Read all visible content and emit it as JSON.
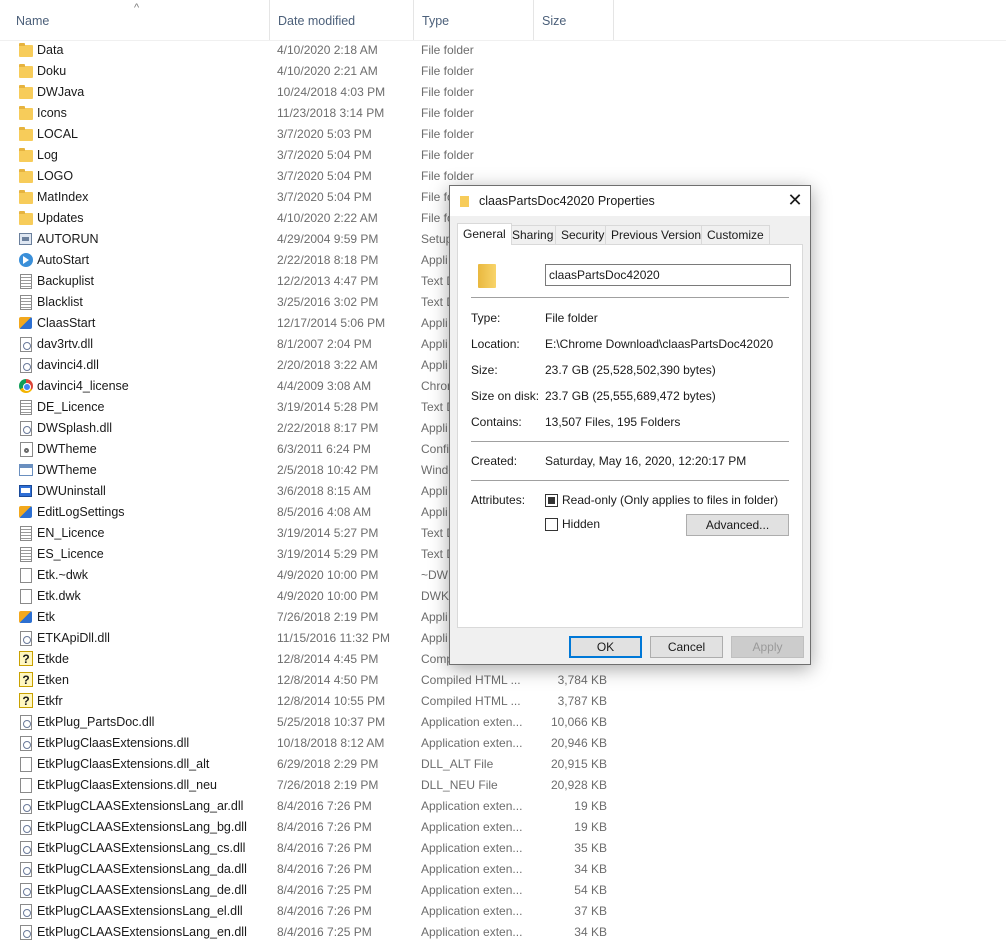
{
  "columns": {
    "name": "Name",
    "date": "Date modified",
    "type": "Type",
    "size": "Size"
  },
  "files": [
    {
      "icon": "folder-icon",
      "name": "Data",
      "date": "4/10/2020 2:18 AM",
      "type": "File folder",
      "size": ""
    },
    {
      "icon": "folder-icon",
      "name": "Doku",
      "date": "4/10/2020 2:21 AM",
      "type": "File folder",
      "size": ""
    },
    {
      "icon": "folder-icon",
      "name": "DWJava",
      "date": "10/24/2018 4:03 PM",
      "type": "File folder",
      "size": ""
    },
    {
      "icon": "folder-icon",
      "name": "Icons",
      "date": "11/23/2018 3:14 PM",
      "type": "File folder",
      "size": ""
    },
    {
      "icon": "folder-icon",
      "name": "LOCAL",
      "date": "3/7/2020 5:03 PM",
      "type": "File folder",
      "size": ""
    },
    {
      "icon": "folder-icon",
      "name": "Log",
      "date": "3/7/2020 5:04 PM",
      "type": "File folder",
      "size": ""
    },
    {
      "icon": "folder-icon",
      "name": "LOGO",
      "date": "3/7/2020 5:04 PM",
      "type": "File folder",
      "size": ""
    },
    {
      "icon": "folder-icon",
      "name": "MatIndex",
      "date": "3/7/2020 5:04 PM",
      "type": "File fo",
      "size": ""
    },
    {
      "icon": "folder-icon",
      "name": "Updates",
      "date": "4/10/2020 2:22 AM",
      "type": "File fo",
      "size": ""
    },
    {
      "icon": "setup-icon",
      "name": "AUTORUN",
      "date": "4/29/2004 9:59 PM",
      "type": "Setup",
      "size": ""
    },
    {
      "icon": "autostart-icon",
      "name": "AutoStart",
      "date": "2/22/2018 8:18 PM",
      "type": "Appli",
      "size": ""
    },
    {
      "icon": "text-file-icon",
      "name": "Backuplist",
      "date": "12/2/2013 4:47 PM",
      "type": "Text D",
      "size": ""
    },
    {
      "icon": "text-file-icon",
      "name": "Blacklist",
      "date": "3/25/2016 3:02 PM",
      "type": "Text D",
      "size": ""
    },
    {
      "icon": "app-icon",
      "name": "ClaasStart",
      "date": "12/17/2014 5:06 PM",
      "type": "Appli",
      "size": ""
    },
    {
      "icon": "dll-icon",
      "name": "dav3rtv.dll",
      "date": "8/1/2007 2:04 PM",
      "type": "Appli",
      "size": ""
    },
    {
      "icon": "dll-icon",
      "name": "davinci4.dll",
      "date": "2/20/2018 3:22 AM",
      "type": "Appli",
      "size": ""
    },
    {
      "icon": "chrome-icon",
      "name": "davinci4_license",
      "date": "4/4/2009 3:08 AM",
      "type": "Chron",
      "size": ""
    },
    {
      "icon": "text-file-icon",
      "name": "DE_Licence",
      "date": "3/19/2014 5:28 PM",
      "type": "Text D",
      "size": ""
    },
    {
      "icon": "dll-icon",
      "name": "DWSplash.dll",
      "date": "2/22/2018 8:17 PM",
      "type": "Appli",
      "size": ""
    },
    {
      "icon": "config-icon",
      "name": "DWTheme",
      "date": "6/3/2011 6:24 PM",
      "type": "Confi",
      "size": ""
    },
    {
      "icon": "window-icon",
      "name": "DWTheme",
      "date": "2/5/2018 10:42 PM",
      "type": "Windo",
      "size": ""
    },
    {
      "icon": "app-window-icon",
      "name": "DWUninstall",
      "date": "3/6/2018 8:15 AM",
      "type": "Appli",
      "size": ""
    },
    {
      "icon": "app-icon",
      "name": "EditLogSettings",
      "date": "8/5/2016 4:08 AM",
      "type": "Appli",
      "size": ""
    },
    {
      "icon": "text-file-icon",
      "name": "EN_Licence",
      "date": "3/19/2014 5:27 PM",
      "type": "Text D",
      "size": ""
    },
    {
      "icon": "text-file-icon",
      "name": "ES_Licence",
      "date": "3/19/2014 5:29 PM",
      "type": "Text D",
      "size": ""
    },
    {
      "icon": "file-icon",
      "name": "Etk.~dwk",
      "date": "4/9/2020 10:00 PM",
      "type": "~DW",
      "size": ""
    },
    {
      "icon": "file-icon",
      "name": "Etk.dwk",
      "date": "4/9/2020 10:00 PM",
      "type": "DWK",
      "size": ""
    },
    {
      "icon": "app-icon",
      "name": "Etk",
      "date": "7/26/2018 2:19 PM",
      "type": "Appli",
      "size": ""
    },
    {
      "icon": "dll-icon",
      "name": "ETKApiDll.dll",
      "date": "11/15/2016 11:32 PM",
      "type": "Appli",
      "size": ""
    },
    {
      "icon": "help-file-icon",
      "name": "Etkde",
      "date": "12/8/2014 4:45 PM",
      "type": "Comp",
      "size": ""
    },
    {
      "icon": "help-file-icon",
      "name": "Etken",
      "date": "12/8/2014 4:50 PM",
      "type": "Compiled HTML ...",
      "size": "3,784 KB"
    },
    {
      "icon": "help-file-icon",
      "name": "Etkfr",
      "date": "12/8/2014 10:55 PM",
      "type": "Compiled HTML ...",
      "size": "3,787 KB"
    },
    {
      "icon": "dll-icon",
      "name": "EtkPlug_PartsDoc.dll",
      "date": "5/25/2018 10:37 PM",
      "type": "Application exten...",
      "size": "10,066 KB"
    },
    {
      "icon": "dll-icon",
      "name": "EtkPlugClaasExtensions.dll",
      "date": "10/18/2018 8:12 AM",
      "type": "Application exten...",
      "size": "20,946 KB"
    },
    {
      "icon": "file-icon",
      "name": "EtkPlugClaasExtensions.dll_alt",
      "date": "6/29/2018 2:29 PM",
      "type": "DLL_ALT File",
      "size": "20,915 KB"
    },
    {
      "icon": "file-icon",
      "name": "EtkPlugClaasExtensions.dll_neu",
      "date": "7/26/2018 2:19 PM",
      "type": "DLL_NEU File",
      "size": "20,928 KB"
    },
    {
      "icon": "dll-icon",
      "name": "EtkPlugCLAASExtensionsLang_ar.dll",
      "date": "8/4/2016 7:26 PM",
      "type": "Application exten...",
      "size": "19 KB"
    },
    {
      "icon": "dll-icon",
      "name": "EtkPlugCLAASExtensionsLang_bg.dll",
      "date": "8/4/2016 7:26 PM",
      "type": "Application exten...",
      "size": "19 KB"
    },
    {
      "icon": "dll-icon",
      "name": "EtkPlugCLAASExtensionsLang_cs.dll",
      "date": "8/4/2016 7:26 PM",
      "type": "Application exten...",
      "size": "35 KB"
    },
    {
      "icon": "dll-icon",
      "name": "EtkPlugCLAASExtensionsLang_da.dll",
      "date": "8/4/2016 7:26 PM",
      "type": "Application exten...",
      "size": "34 KB"
    },
    {
      "icon": "dll-icon",
      "name": "EtkPlugCLAASExtensionsLang_de.dll",
      "date": "8/4/2016 7:25 PM",
      "type": "Application exten...",
      "size": "54 KB"
    },
    {
      "icon": "dll-icon",
      "name": "EtkPlugCLAASExtensionsLang_el.dll",
      "date": "8/4/2016 7:26 PM",
      "type": "Application exten...",
      "size": "37 KB"
    },
    {
      "icon": "dll-icon",
      "name": "EtkPlugCLAASExtensionsLang_en.dll",
      "date": "8/4/2016 7:25 PM",
      "type": "Application exten...",
      "size": "34 KB"
    }
  ],
  "dialog": {
    "title": "claasPartsDoc42020 Properties",
    "close_glyph": "✕",
    "tabs": [
      "General",
      "Sharing",
      "Security",
      "Previous Versions",
      "Customize"
    ],
    "folder_name": "claasPartsDoc42020",
    "labels": {
      "type": "Type:",
      "location": "Location:",
      "size": "Size:",
      "size_on_disk": "Size on disk:",
      "contains": "Contains:",
      "created": "Created:",
      "attributes": "Attributes:"
    },
    "values": {
      "type": "File folder",
      "location": "E:\\Chrome Download\\claasPartsDoc42020",
      "size": "23.7 GB (25,528,502,390 bytes)",
      "size_on_disk": "23.7 GB (25,555,689,472 bytes)",
      "contains": "13,507 Files, 195 Folders",
      "created": "Saturday, May 16, 2020, 12:20:17 PM"
    },
    "readonly_label": "Read-only (Only applies to files in folder)",
    "readonly_state": "indeterminate",
    "hidden_label": "Hidden",
    "hidden_checked": false,
    "advanced_label": "Advanced...",
    "ok_label": "OK",
    "cancel_label": "Cancel",
    "apply_label": "Apply"
  }
}
